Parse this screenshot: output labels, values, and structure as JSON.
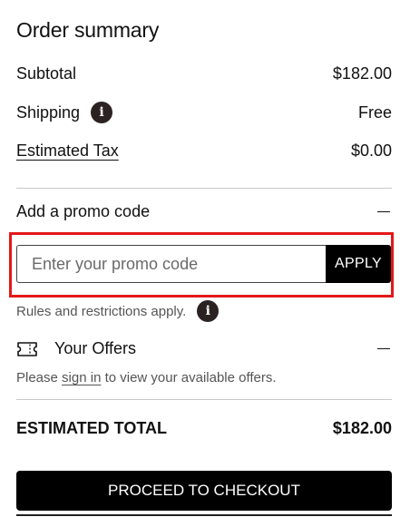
{
  "summary": {
    "title": "Order summary",
    "subtotal_label": "Subtotal",
    "subtotal_value": "$182.00",
    "shipping_label": "Shipping",
    "shipping_value": "Free",
    "tax_label": "Estimated Tax",
    "tax_value": "$0.00"
  },
  "promo": {
    "heading": "Add a promo code",
    "placeholder": "Enter your promo code",
    "value": "",
    "apply_label": "APPLY",
    "rules_text": "Rules and restrictions apply."
  },
  "offers": {
    "heading": "Your Offers",
    "text_before": "Please ",
    "link_text": "sign in",
    "text_after": " to view your available offers."
  },
  "total": {
    "label": "ESTIMATED TOTAL",
    "value": "$182.00"
  },
  "checkout": {
    "label": "PROCEED TO CHECKOUT"
  },
  "icons": {
    "info": "info-icon",
    "collapse": "minus-icon",
    "offers": "ticket-icon"
  },
  "colors": {
    "highlight": "#e41818",
    "button_bg": "#000000",
    "info_icon_bg": "#2b2222"
  }
}
